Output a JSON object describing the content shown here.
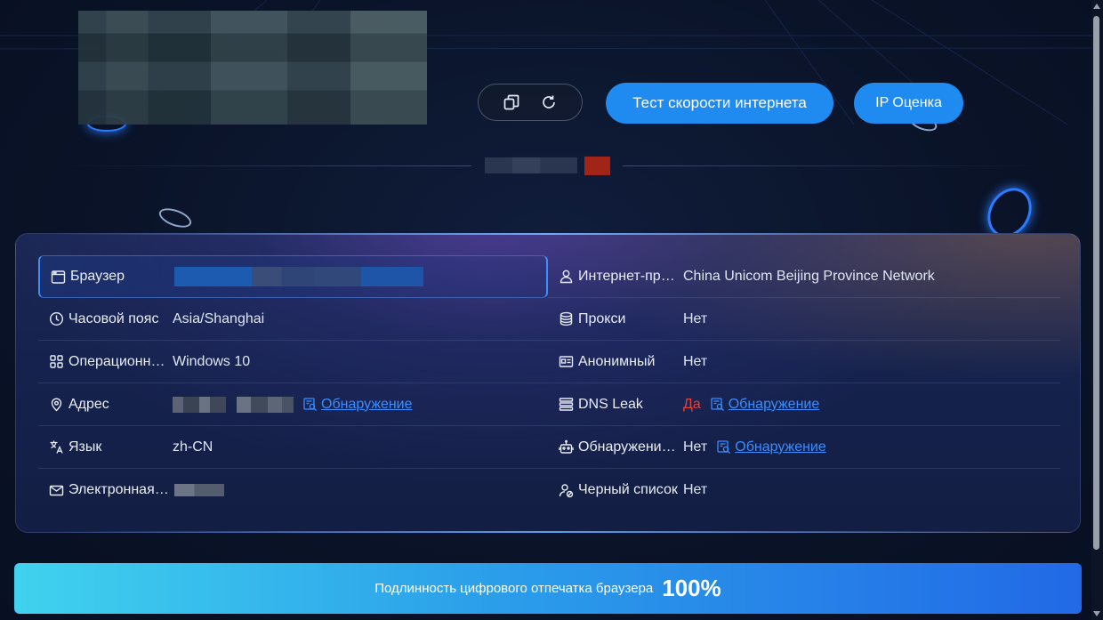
{
  "colors": {
    "accent": "#1f8bf0",
    "link": "#3a8dff",
    "danger": "#e0443a",
    "flag": "#a12418"
  },
  "header": {
    "copy_icon": "copy-icon",
    "refresh_icon": "refresh-icon",
    "speed_test_label": "Тест скорости интернета",
    "ip_score_label": "IP Оценка"
  },
  "info": {
    "left": [
      {
        "icon": "browser-icon",
        "label": "Браузер",
        "value": ""
      },
      {
        "icon": "clock-icon",
        "label": "Часовой пояс",
        "value": "Asia/Shanghai"
      },
      {
        "icon": "grid-icon",
        "label": "Операционная система",
        "value": "Windows 10"
      },
      {
        "icon": "location-pin-icon",
        "label": "Адрес",
        "value": "",
        "link": "Обнаружение"
      },
      {
        "icon": "translate-icon",
        "label": "Язык",
        "value": "zh-CN"
      },
      {
        "icon": "mail-icon",
        "label": "Электронная почта",
        "value": ""
      }
    ],
    "right": [
      {
        "icon": "person-icon",
        "label": "Интернет-провайдер",
        "value": "China Unicom Beijing Province Network"
      },
      {
        "icon": "database-icon",
        "label": "Прокси",
        "value": "Нет"
      },
      {
        "icon": "id-card-icon",
        "label": "Анонимный",
        "value": "Нет"
      },
      {
        "icon": "list-icon",
        "label": "DNS Leak",
        "value": "Да",
        "link": "Обнаружение"
      },
      {
        "icon": "robot-icon",
        "label": "Обнаружение бота",
        "value": "Нет",
        "link": "Обнаружение"
      },
      {
        "icon": "user-block-icon",
        "label": "Черный список",
        "value": "Нет"
      }
    ]
  },
  "auth_bar": {
    "text": "Подлинность цифрового отпечатка браузера",
    "percent": "100%"
  }
}
